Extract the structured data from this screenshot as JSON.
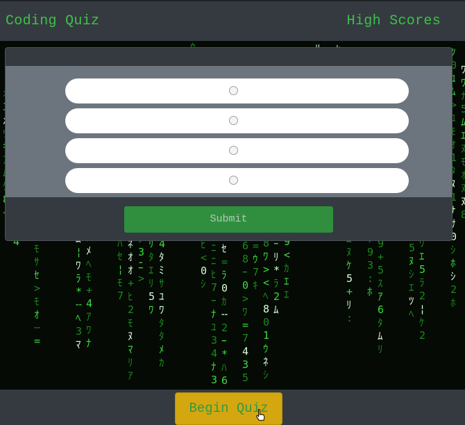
{
  "navbar": {
    "brand": "Coding Quiz",
    "high_scores": "High Scores"
  },
  "quiz": {
    "question": "",
    "answers": [
      "",
      "",
      "",
      ""
    ],
    "submit_label": "Submit"
  },
  "begin_button": {
    "label": "Begin Quiz"
  },
  "colors": {
    "accent_green": "#3cc247",
    "submit_green": "#2f8f3e",
    "begin_yellow": "#d4a711",
    "dark_bar": "#343a40",
    "card_body": "#6c757d"
  },
  "icons": {
    "cursor": "hand-pointer-icon",
    "radio": "radio-button-icon"
  }
}
